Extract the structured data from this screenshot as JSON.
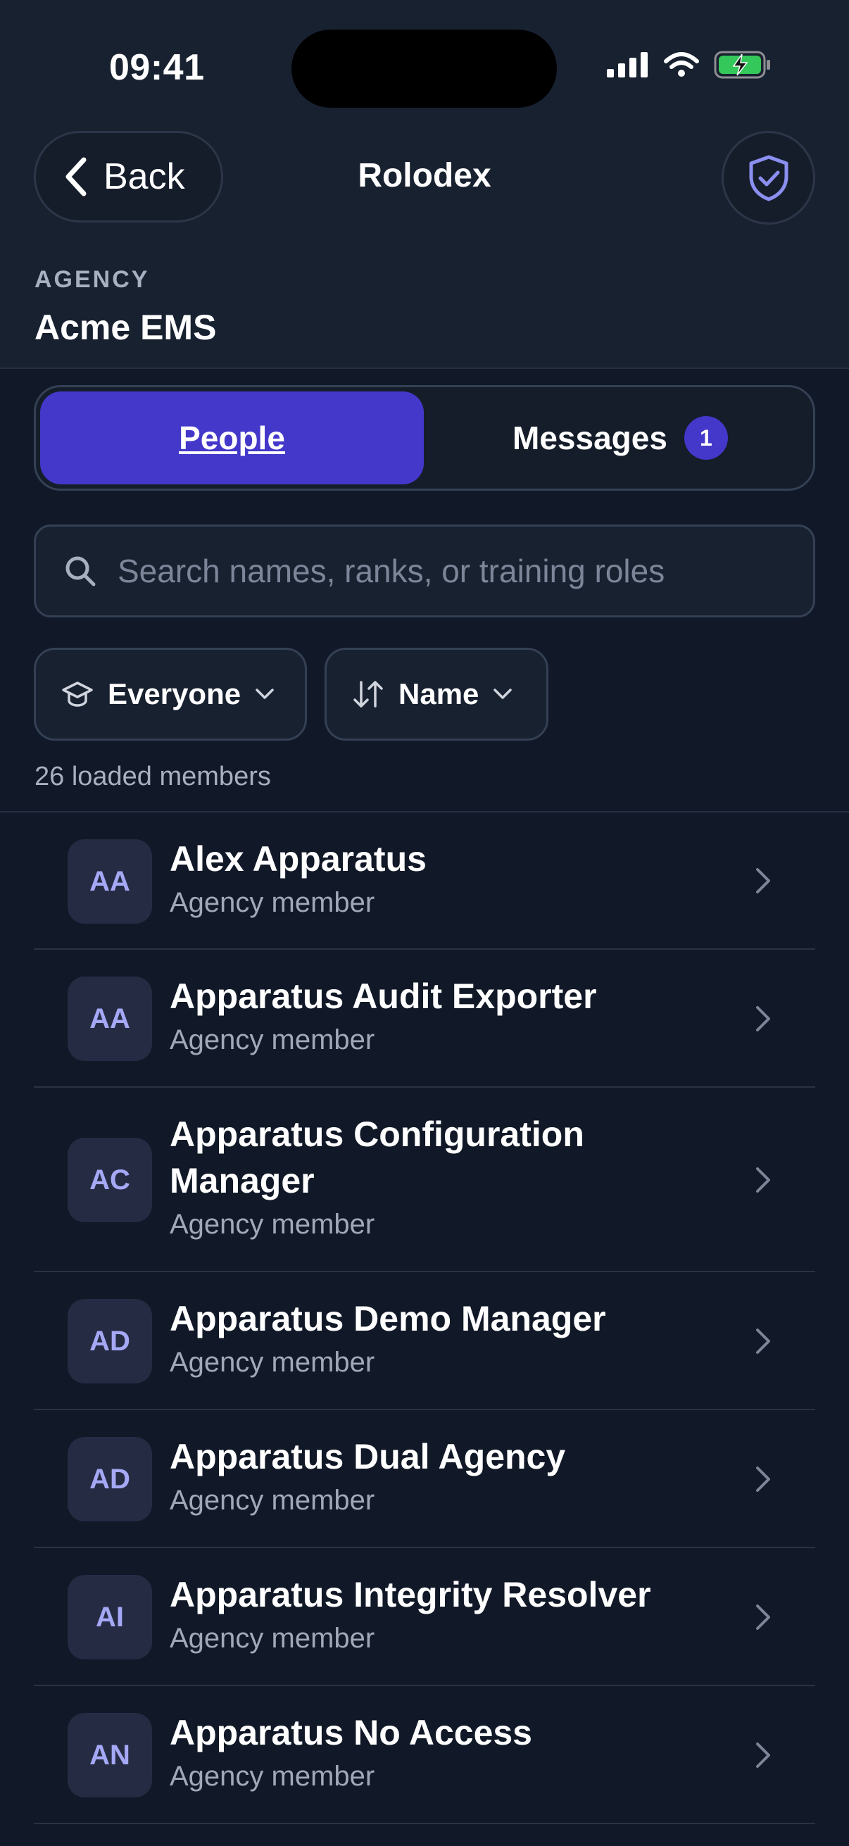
{
  "status_bar": {
    "time": "09:41"
  },
  "header": {
    "back_label": "Back",
    "title": "Rolodex",
    "agency_label": "AGENCY",
    "agency_name": "Acme EMS"
  },
  "tabs": {
    "people_label": "People",
    "messages_label": "Messages",
    "messages_badge": "1",
    "active": "People"
  },
  "search": {
    "placeholder": "Search names, ranks, or training roles",
    "value": ""
  },
  "filters": {
    "audience_label": "Everyone",
    "sort_label": "Name"
  },
  "member_count_text": "26 loaded members",
  "members": [
    {
      "initials": "AA",
      "name": "Alex Apparatus",
      "role": "Agency member"
    },
    {
      "initials": "AA",
      "name": "Apparatus Audit Exporter",
      "role": "Agency member"
    },
    {
      "initials": "AC",
      "name": "Apparatus Configuration Manager",
      "role": "Agency member"
    },
    {
      "initials": "AD",
      "name": "Apparatus Demo Manager",
      "role": "Agency member"
    },
    {
      "initials": "AD",
      "name": "Apparatus Dual Agency",
      "role": "Agency member"
    },
    {
      "initials": "AI",
      "name": "Apparatus Integrity Resolver",
      "role": "Agency member"
    },
    {
      "initials": "AN",
      "name": "Apparatus No Access",
      "role": "Agency member"
    }
  ],
  "colors": {
    "background": "#111827",
    "header_background": "#182130",
    "accent": "#4338ca",
    "avatar_text": "#a5a8f5",
    "muted_text": "#a1a9b8",
    "battery": "#34c759"
  },
  "icons": {
    "status": [
      "cellular-signal-icon",
      "wifi-icon",
      "battery-charging-icon"
    ],
    "back": "chevron-left-icon",
    "verified": "shield-check-icon",
    "search": "search-icon",
    "audience": "graduation-cap-icon",
    "sort": "sort-arrows-icon",
    "dropdown": "chevron-down-icon",
    "row": "chevron-right-icon"
  }
}
